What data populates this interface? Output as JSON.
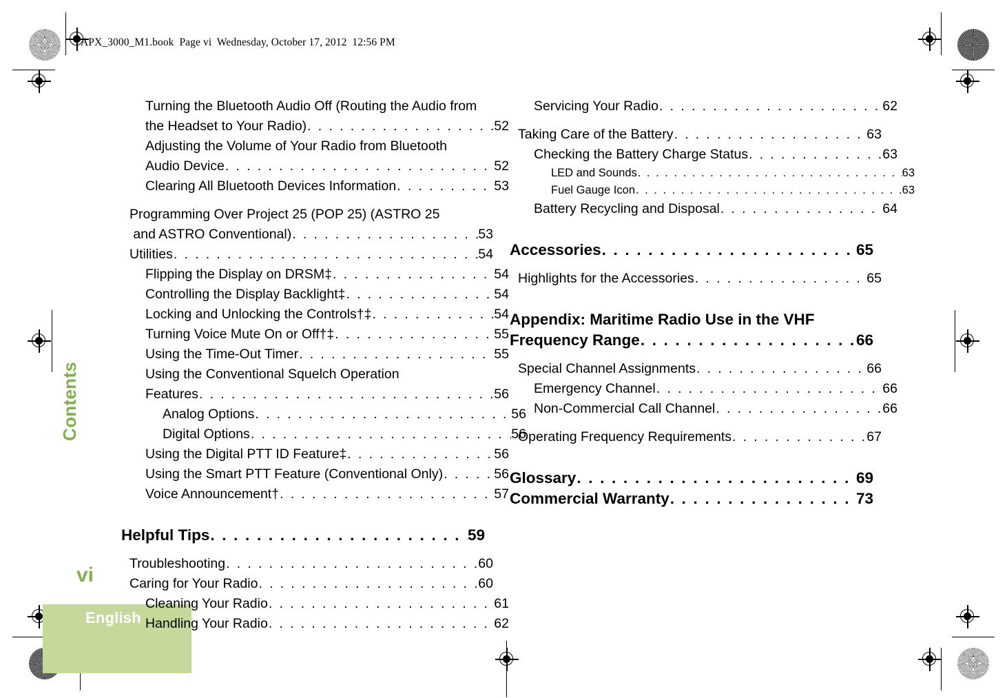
{
  "doc_header": "APX_3000_M1.book  Page vi  Wednesday, October 17, 2012  12:56 PM",
  "running_head": "Contents",
  "folio": "vi",
  "language_tab": "English",
  "colors": {
    "accent_green_text": "#82b04e",
    "tab_background": "#c5d99a",
    "tab_label": "#ffffff"
  },
  "leader": ". . . . . . . . . . . . . . . . . . . . . . . . . . . . . . . . . . . . . . . . . . . . . . . . . . . . . . . . . .",
  "left_column": [
    {
      "label": "Turning the Bluetooth Audio Off (Routing the Audio from",
      "wrap": true,
      "level": 2
    },
    {
      "label": "the Headset to Your Radio)",
      "page": "52",
      "level": 2
    },
    {
      "label": "Adjusting the Volume of Your Radio from Bluetooth",
      "wrap": true,
      "level": 2
    },
    {
      "label": "Audio Device",
      "page": "52",
      "level": 2
    },
    {
      "label": "Clearing All Bluetooth Devices Information",
      "page": "53",
      "level": 2
    },
    {
      "label": "Programming Over Project 25 (POP 25) (ASTRO 25",
      "wrap": true,
      "level": 1
    },
    {
      "label": " and ASTRO Conventional)",
      "page": "53",
      "level": 1
    },
    {
      "label": "Utilities",
      "page": "54",
      "level": 1
    },
    {
      "label": "Flipping the Display on DRSM‡",
      "page": "54",
      "level": 2
    },
    {
      "label": "Controlling the Display Backlight‡",
      "page": "54",
      "level": 2
    },
    {
      "label": "Locking and Unlocking the Controls†‡",
      "page": "54",
      "level": 2
    },
    {
      "label": "Turning Voice Mute On or Off†‡",
      "page": "55",
      "level": 2
    },
    {
      "label": "Using the Time-Out Timer",
      "page": "55",
      "level": 2
    },
    {
      "label": "Using the Conventional Squelch Operation",
      "wrap": true,
      "level": 2
    },
    {
      "label": "Features",
      "page": "56",
      "level": 2
    },
    {
      "label": "Analog Options",
      "page": "56",
      "level": 3
    },
    {
      "label": "Digital Options",
      "page": "56",
      "level": 3
    },
    {
      "label": "Using the Digital PTT ID Feature‡",
      "page": "56",
      "level": 2
    },
    {
      "label": "Using the Smart PTT Feature (Conventional Only)",
      "page": "56",
      "level": 2
    },
    {
      "label": "Voice Announcement†",
      "page": "57",
      "level": 2
    },
    {
      "label": "Helpful Tips",
      "page": "59",
      "level": 0,
      "chapter": true
    },
    {
      "label": "Troubleshooting",
      "page": "60",
      "level": 1
    },
    {
      "label": "Caring for Your Radio",
      "page": "60",
      "level": 1
    },
    {
      "label": "Cleaning Your Radio",
      "page": "61",
      "level": 2
    },
    {
      "label": "Handling Your Radio",
      "page": "62",
      "level": 2
    }
  ],
  "right_column": [
    {
      "label": "Servicing Your Radio",
      "page": "62",
      "level": 2
    },
    {
      "label": "Taking Care of the Battery",
      "page": "63",
      "level": 1
    },
    {
      "label": "Checking the Battery Charge Status",
      "page": "63",
      "level": 2
    },
    {
      "label": "LED and Sounds",
      "page": "63",
      "level": 3,
      "small": true
    },
    {
      "label": "Fuel Gauge Icon",
      "page": "63",
      "level": 3,
      "small": true
    },
    {
      "label": "Battery Recycling and Disposal",
      "page": "64",
      "level": 2
    },
    {
      "label": "Accessories",
      "page": "65",
      "level": 0,
      "chapter": true
    },
    {
      "label": "Highlights for the Accessories",
      "page": "65",
      "level": 1
    },
    {
      "label": "Appendix: Maritime Radio Use in the VHF",
      "wrap": true,
      "level": 0,
      "chapter": true
    },
    {
      "label": "Frequency Range",
      "page": "66",
      "level": 0,
      "chapter": true
    },
    {
      "label": "Special Channel Assignments",
      "page": "66",
      "level": 1
    },
    {
      "label": "Emergency Channel",
      "page": "66",
      "level": 2
    },
    {
      "label": "Non-Commercial Call Channel",
      "page": "66",
      "level": 2
    },
    {
      "label": "Operating Frequency Requirements",
      "page": "67",
      "level": 1
    },
    {
      "label": "Glossary",
      "page": "69",
      "level": 0,
      "chapter": true
    },
    {
      "label": "Commercial Warranty",
      "page": "73",
      "level": 0,
      "chapter": true
    }
  ]
}
